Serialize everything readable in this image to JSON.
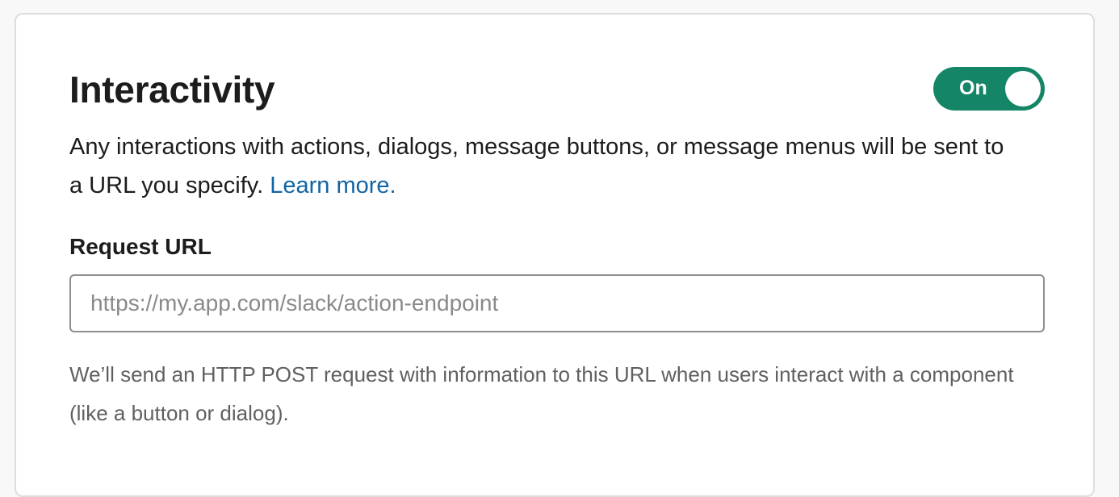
{
  "section": {
    "title": "Interactivity",
    "toggle": {
      "label": "On",
      "state": "on",
      "color": "#148567"
    },
    "description": "Any interactions with actions, dialogs, message buttons, or message menus will be sent to a URL you specify.",
    "learn_more_label": "Learn more.",
    "link_color": "#1264a3"
  },
  "request_url": {
    "label": "Request URL",
    "value": "",
    "placeholder": "https://my.app.com/slack/action-endpoint",
    "hint": "We’ll send an HTTP POST request with information to this URL when users interact with a component (like a button or dialog)."
  }
}
